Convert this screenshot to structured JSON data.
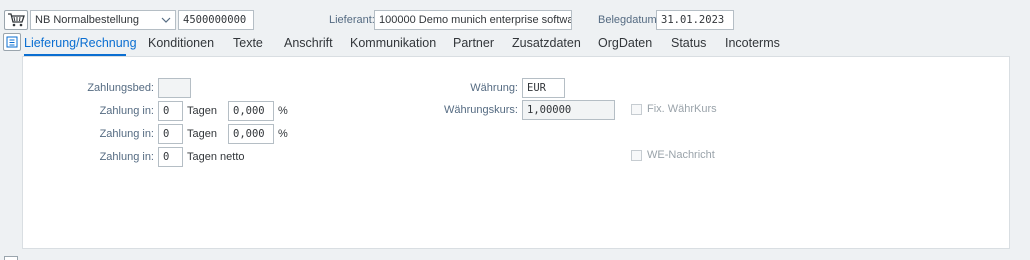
{
  "header": {
    "order_type": "NB Normalbestellung",
    "po_number": "4500000000",
    "vendor_label": "Lieferant:",
    "vendor_value": "100000 Demo munich enterprise software ...",
    "doc_date_label": "Belegdatum:",
    "doc_date_value": "31.01.2023"
  },
  "tabs": [
    {
      "label": "Lieferung/Rechnung",
      "active": true
    },
    {
      "label": "Konditionen"
    },
    {
      "label": "Texte"
    },
    {
      "label": "Anschrift"
    },
    {
      "label": "Kommunikation"
    },
    {
      "label": "Partner"
    },
    {
      "label": "Zusatzdaten"
    },
    {
      "label": "OrgDaten"
    },
    {
      "label": "Status"
    },
    {
      "label": "Incoterms"
    }
  ],
  "form": {
    "zahlungsbed_label": "Zahlungsbed:",
    "zahlungsbed_value": "",
    "zahlung1_label": "Zahlung in:",
    "zahlung1_days": "0",
    "zahlung1_tagen": "Tagen",
    "zahlung1_pct": "0,000",
    "zahlung1_pct_sign": "%",
    "zahlung2_label": "Zahlung in:",
    "zahlung2_days": "0",
    "zahlung2_tagen": "Tagen",
    "zahlung2_pct": "0,000",
    "zahlung2_pct_sign": "%",
    "zahlung3_label": "Zahlung in:",
    "zahlung3_days": "0",
    "zahlung3_tagen": "Tagen netto",
    "waehrung_label": "Währung:",
    "waehrung_value": "EUR",
    "kurs_label": "Währungskurs:",
    "kurs_value": "1,00000",
    "fix_label": "Fix. WährKurs",
    "fix_checked": false,
    "we_label": "WE-Nachricht",
    "we_checked": false
  },
  "colors": {
    "accent": "#0a6ed1",
    "background": "#eef1f3",
    "label": "#556b82"
  },
  "icons": {
    "order_type": "shopping-cart-icon",
    "dropdown": "chevron-down-icon",
    "collapse": "collapse-header-icon"
  }
}
